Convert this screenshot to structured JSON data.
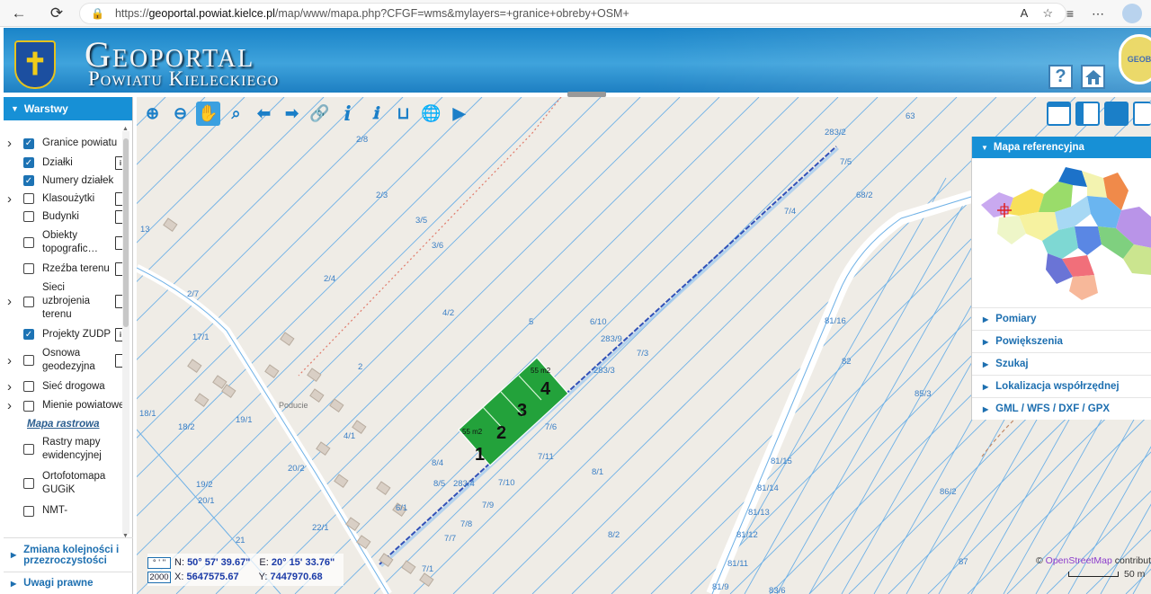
{
  "browser": {
    "url_prefix": "https://",
    "url_host": "geoportal.powiat.kielce.pl",
    "url_path": "/map/www/mapa.php?CFGF=wms&mylayers=+granice+obreby+OSM+"
  },
  "header": {
    "title_line1": "Geoportal",
    "title_line2": "Powiatu Kieleckiego",
    "help_label": "?",
    "geo_badge": "GEOB"
  },
  "left_panel": {
    "title": "Warstwy",
    "layers": [
      {
        "label": "Granice powiatu",
        "checked": true,
        "expandable": true,
        "doc": false
      },
      {
        "label": "Działki",
        "checked": true,
        "expandable": false,
        "doc": "info"
      },
      {
        "label": "Numery działek",
        "checked": true,
        "expandable": false,
        "doc": false
      },
      {
        "label": "Klasoużytki",
        "checked": false,
        "expandable": true,
        "doc": "plain"
      },
      {
        "label": "Budynki",
        "checked": false,
        "expandable": false,
        "doc": "plain"
      },
      {
        "label": "Obiekty topografic…",
        "checked": false,
        "expandable": false,
        "doc": "plain"
      },
      {
        "label": "Rzeźba terenu",
        "checked": false,
        "expandable": false,
        "doc": "plain"
      },
      {
        "label": "Sieci uzbrojenia terenu",
        "checked": false,
        "expandable": true,
        "doc": "plain"
      },
      {
        "label": "Projekty ZUDP",
        "checked": true,
        "expandable": false,
        "doc": "info"
      },
      {
        "label": "Osnowa geodezyjna",
        "checked": false,
        "expandable": true,
        "doc": "plain"
      },
      {
        "label": "Sieć drogowa",
        "checked": false,
        "expandable": true,
        "doc": false
      },
      {
        "label": "Mienie powiatowe",
        "checked": false,
        "expandable": true,
        "doc": false
      }
    ],
    "raster_section": "Mapa rastrowa",
    "raster_layers": [
      {
        "label": "Rastry mapy ewidencyjnej",
        "checked": false
      },
      {
        "label": "Ortofotomapa GUGiK",
        "checked": false
      },
      {
        "label": "NMT-",
        "checked": false
      }
    ],
    "footer_items": [
      "Zmiana kolejności i przezroczystości",
      "Uwagi prawne"
    ]
  },
  "right_panel": {
    "title": "Mapa referencyjna",
    "items": [
      "Pomiary",
      "Powiększenia",
      "Szukaj",
      "Lokalizacja współrzędnej",
      "GML / WFS / DXF / GPX"
    ]
  },
  "map": {
    "parcel_labels": [
      "2/8",
      "2/3",
      "3/5",
      "3/6",
      "2/4",
      "4/2",
      "5",
      "6/10",
      "283/9",
      "7/3",
      "283/3",
      "7/4",
      "7/5",
      "283/2",
      "63",
      "68/2",
      "81/16",
      "82",
      "85/3",
      "86/2",
      "87",
      "7/6",
      "7/11",
      "8/1",
      "8/4",
      "8/5",
      "283/4",
      "7/10",
      "7/9",
      "7/8",
      "7/7",
      "8/2",
      "7/1",
      "81/15",
      "81/14",
      "81/13",
      "81/12",
      "81/11",
      "81/9",
      "83/6",
      "2/7",
      "17/1",
      "18/1",
      "18/2",
      "19/1",
      "19/2",
      "20/1",
      "20/2",
      "22/1",
      "21",
      "4/1",
      "6/1",
      "2",
      "13"
    ],
    "area_labels": [
      "55 m2",
      "55 m2"
    ],
    "plot_numbers": [
      "1",
      "2",
      "3",
      "4"
    ],
    "place_name": "Poducie"
  },
  "coords": {
    "mode1": "° ' \"",
    "mode2": "2000",
    "n_label": "N:",
    "n_value": "50° 57' 39.67\"",
    "e_label": "E:",
    "e_value": "20° 15' 33.76\"",
    "x_label": "X:",
    "x_value": "5647575.67",
    "y_label": "Y:",
    "y_value": "7447970.68"
  },
  "attribution": {
    "prefix": "©",
    "osm": "OpenStreetMap",
    "suffix": "contributo"
  },
  "scale_label": "50 m"
}
